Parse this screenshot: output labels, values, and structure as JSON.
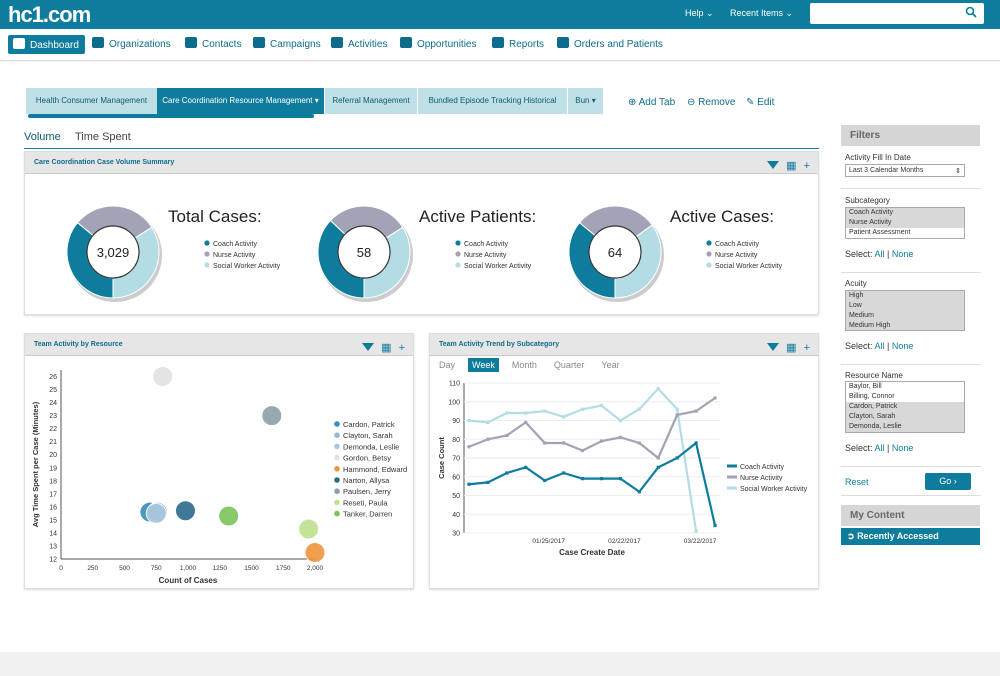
{
  "app": {
    "logo": "hc1.com",
    "nav_help": "Help ⌄",
    "nav_recent": "Recent Items ⌄"
  },
  "nav": [
    {
      "label": "Dashboard",
      "icon": "dashboard-icon"
    },
    {
      "label": "Organizations",
      "icon": "building-icon"
    },
    {
      "label": "Contacts",
      "icon": "person-icon"
    },
    {
      "label": "Campaigns",
      "icon": "campaign-icon"
    },
    {
      "label": "Activities",
      "icon": "briefcase-icon"
    },
    {
      "label": "Opportunities",
      "icon": "money-icon"
    },
    {
      "label": "Reports",
      "icon": "report-icon"
    },
    {
      "label": "Orders and Patients",
      "icon": "caduceus-icon"
    }
  ],
  "tabs": [
    "Health Consumer Management",
    "Care Coordination Resource Management",
    "Referral Management",
    "Bundled Episode Tracking Historical",
    "Bun"
  ],
  "tab_actions": {
    "add": "Add Tab",
    "remove": "Remove",
    "edit": "Edit"
  },
  "subtabs": {
    "volume": "Volume",
    "time": "Time Spent"
  },
  "summary": {
    "title": "Care Coordination Case Volume Summary",
    "legend": [
      "Coach Activity",
      "Nurse Activity",
      "Social Worker Activity"
    ],
    "donuts": [
      {
        "title": "Total Cases:",
        "value": "3,029",
        "shares": [
          0.36,
          0.3,
          0.34
        ]
      },
      {
        "title": "Active Patients:",
        "value": "58",
        "shares": [
          0.37,
          0.29,
          0.34
        ]
      },
      {
        "title": "Active Cases:",
        "value": "64",
        "shares": [
          0.36,
          0.29,
          0.35
        ]
      }
    ]
  },
  "colors": {
    "coach": "#0e7c9c",
    "nurse": "#a3a3b8",
    "social": "#b4dce5"
  },
  "chart_data": [
    {
      "type": "scatter",
      "title": "Team Activity by Resource",
      "xlabel": "Count of Cases",
      "ylabel": "Avg Time Spent per Case (Minutes)",
      "xlim": [
        0,
        2000
      ],
      "ylim": [
        12,
        26.5
      ],
      "xticks": [
        0,
        250,
        500,
        750,
        "1,000",
        1250,
        1500,
        1750,
        "2,000"
      ],
      "yticks": [
        12,
        13,
        14,
        15,
        16,
        17,
        18,
        19,
        20,
        21,
        22,
        23,
        24,
        25,
        26
      ],
      "series": [
        {
          "name": "Cardon, Patrick",
          "x": 700,
          "y": 15.6,
          "color": "#3a8fb7"
        },
        {
          "name": "Clayton, Sarah",
          "x": 760,
          "y": 15.6,
          "color": "#9ab6cc"
        },
        {
          "name": "Demonda, Leslie",
          "x": 750,
          "y": 15.5,
          "color": "#a8c8e0"
        },
        {
          "name": "Gordon, Betsy",
          "x": 800,
          "y": 26,
          "color": "#e2e2e2"
        },
        {
          "name": "Hammond, Edward",
          "x": 2000,
          "y": 12.5,
          "color": "#f0953a"
        },
        {
          "name": "Narton, Allysa",
          "x": 980,
          "y": 15.7,
          "color": "#2d6a8a"
        },
        {
          "name": "Paulsen, Jerry",
          "x": 1660,
          "y": 23,
          "color": "#8d9fa8"
        },
        {
          "name": "Reseti, Paula",
          "x": 1950,
          "y": 14.3,
          "color": "#bfe08d"
        },
        {
          "name": "Tanker, Darren",
          "x": 1320,
          "y": 15.3,
          "color": "#7dc25b"
        }
      ]
    },
    {
      "type": "line",
      "title": "Team Activity Trend by Subcategory",
      "xlabel": "Case Create Date",
      "ylabel": "Case Count",
      "ylim": [
        30,
        110
      ],
      "yticks": [
        30,
        40,
        50,
        60,
        70,
        80,
        90,
        100,
        110
      ],
      "xticklabels": [
        "01/25/2017",
        "02/22/2017",
        "03/22/2017"
      ],
      "periods": [
        "Day",
        "Week",
        "Month",
        "Quarter",
        "Year"
      ],
      "active_period": "Week",
      "x": [
        0,
        1,
        2,
        3,
        4,
        5,
        6,
        7,
        8,
        9,
        10,
        11,
        12,
        13,
        14,
        15
      ],
      "series": [
        {
          "name": "Coach Activity",
          "color": "#0e7c9c",
          "values": [
            56,
            57,
            62,
            65,
            58,
            62,
            59,
            59,
            59,
            52,
            65,
            70,
            78,
            34
          ]
        },
        {
          "name": "Nurse Activity",
          "color": "#a3a3b8",
          "values": [
            76,
            80,
            82,
            89,
            78,
            78,
            74,
            79,
            81,
            78,
            70,
            93,
            95,
            102
          ]
        },
        {
          "name": "Social Worker Activity",
          "color": "#b4dce5",
          "values": [
            90,
            89,
            94,
            94,
            95,
            92,
            96,
            98,
            90,
            96,
            107,
            96,
            31
          ]
        }
      ]
    }
  ],
  "filters": {
    "header": "Filters",
    "activity_fill_label": "Activity Fill In Date",
    "activity_fill_value": "Last 3 Calendar Months",
    "subcategory_label": "Subcategory",
    "subcategory_items": [
      "Coach Activity",
      "Nurse Activity",
      "Patient Assessment"
    ],
    "acuity_label": "Acuity",
    "acuity_items": [
      "High",
      "Low",
      "Medium",
      "Medium High"
    ],
    "resource_label": "Resource Name",
    "resource_items": [
      "Baylor, Bill",
      "Billing, Connor",
      "Cardon, Patrick",
      "Clayton, Sarah",
      "Demonda, Leslie"
    ],
    "select_label": "Select:",
    "all": "All",
    "none": "None",
    "reset": "Reset",
    "go": "Go"
  },
  "my_content": {
    "header": "My Content",
    "recent": "Recently Accessed"
  }
}
